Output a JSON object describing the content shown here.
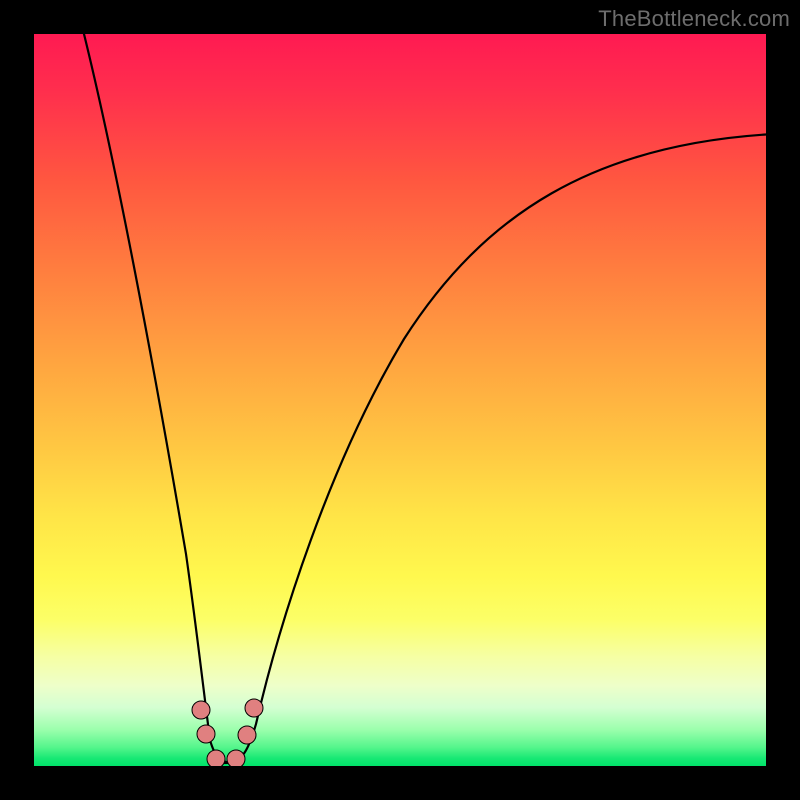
{
  "watermark": {
    "text": "TheBottleneck.com"
  },
  "chart_data": {
    "type": "line",
    "title": "",
    "xlabel": "",
    "ylabel": "",
    "xlim": [
      0,
      100
    ],
    "ylim": [
      0,
      100
    ],
    "grid": false,
    "legend": false,
    "background": "rainbow-gradient (red top → green bottom)",
    "note": "Curve shows bottleneck percentage; minimum (~0%) occurs near x≈23–28.",
    "series": [
      {
        "name": "bottleneck-curve",
        "x": [
          0,
          4,
          8,
          12,
          15,
          18,
          20,
          22,
          23,
          25,
          27,
          28,
          30,
          33,
          36,
          40,
          45,
          50,
          55,
          60,
          65,
          70,
          75,
          80,
          85,
          90,
          95,
          100
        ],
        "y": [
          100,
          85,
          70,
          55,
          42,
          29,
          18,
          7,
          2,
          0,
          0,
          2,
          8,
          18,
          28,
          38,
          48,
          56,
          62,
          67,
          71,
          74,
          77,
          79,
          81,
          82.5,
          83.8,
          85
        ]
      }
    ],
    "markers": [
      {
        "name": "marker-left-upper",
        "x": 22.0,
        "y": 7.0
      },
      {
        "name": "marker-left-lower",
        "x": 22.7,
        "y": 3.5
      },
      {
        "name": "marker-mid-left",
        "x": 24.0,
        "y": 0.5
      },
      {
        "name": "marker-mid-right",
        "x": 27.0,
        "y": 0.5
      },
      {
        "name": "marker-right-lower",
        "x": 28.3,
        "y": 3.5
      },
      {
        "name": "marker-right-upper",
        "x": 29.3,
        "y": 7.5
      }
    ],
    "marker_style": {
      "fill": "#e08080",
      "stroke": "#000000",
      "r": 1.2
    }
  }
}
